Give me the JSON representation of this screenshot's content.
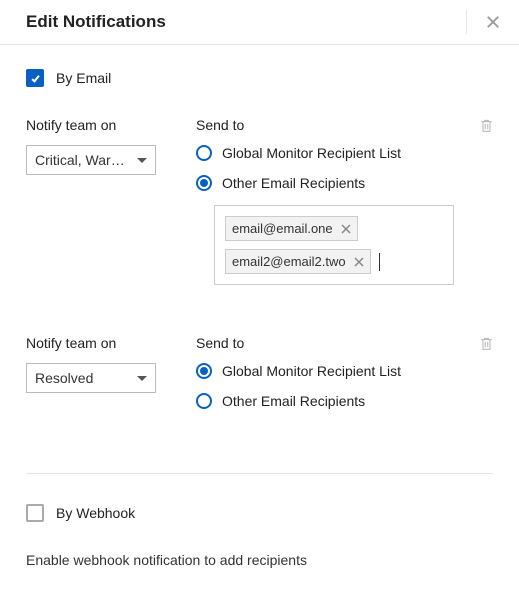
{
  "header": {
    "title": "Edit Notifications"
  },
  "byEmail": {
    "label": "By Email",
    "checked": true
  },
  "block1": {
    "notifyLabel": "Notify team on",
    "selectValue": "Critical, Warn…",
    "sendToLabel": "Send to",
    "radio1": "Global Monitor Recipient List",
    "radio2": "Other Email Recipients",
    "selected": "other",
    "emails": {
      "e1": "email@email.one",
      "e2": "email2@email2.two"
    }
  },
  "block2": {
    "notifyLabel": "Notify team on",
    "selectValue": "Resolved",
    "sendToLabel": "Send to",
    "radio1": "Global Monitor Recipient List",
    "radio2": "Other Email Recipients",
    "selected": "global"
  },
  "byWebhook": {
    "label": "By Webhook",
    "checked": false,
    "helper": "Enable webhook notification to add recipients"
  }
}
